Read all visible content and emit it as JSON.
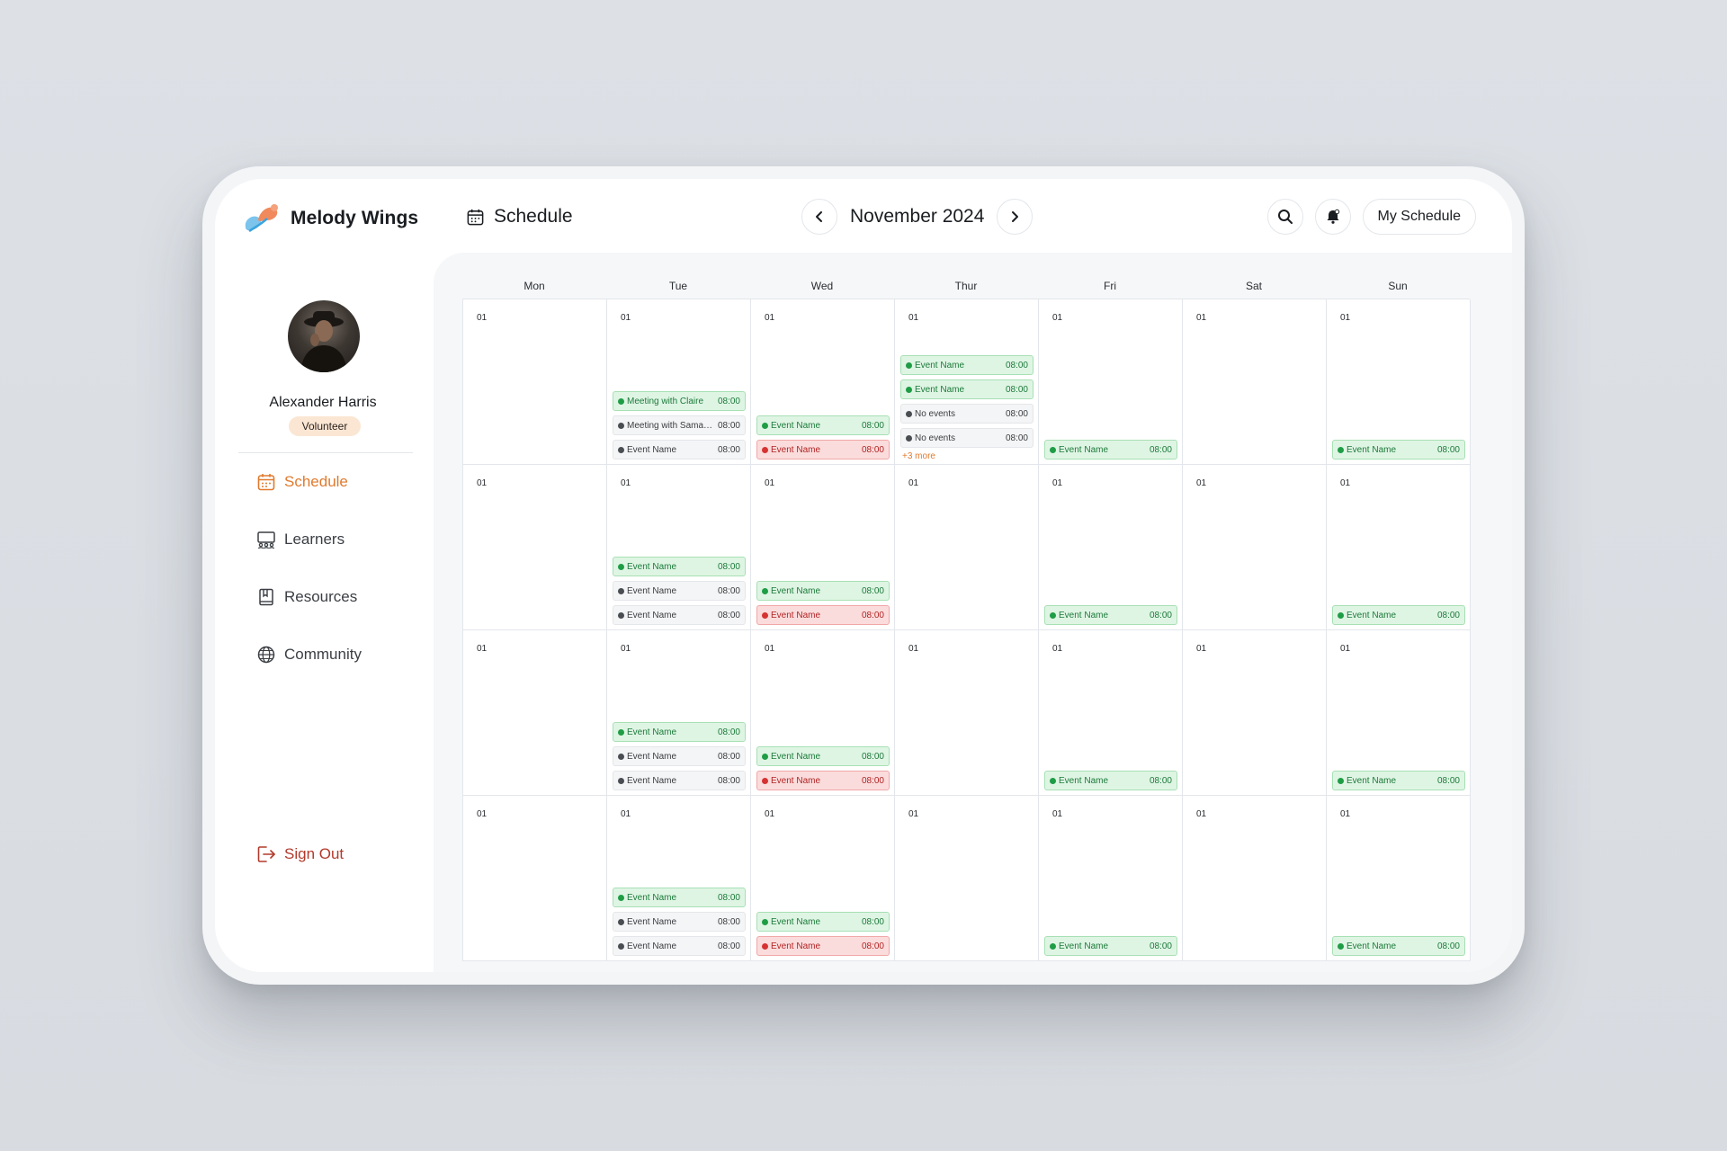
{
  "app": {
    "name": "Melody Wings"
  },
  "header": {
    "page_title": "Schedule",
    "month": "November 2024",
    "my_schedule_label": "My Schedule"
  },
  "user": {
    "name": "Alexander Harris",
    "role": "Volunteer"
  },
  "sidebar": {
    "items": [
      {
        "label": "Schedule",
        "icon": "calendar-icon",
        "active": true
      },
      {
        "label": "Learners",
        "icon": "learners-icon"
      },
      {
        "label": "Resources",
        "icon": "book-icon"
      },
      {
        "label": "Community",
        "icon": "globe-icon"
      }
    ],
    "sign_out": "Sign Out"
  },
  "colors": {
    "accent": "#e07a2e",
    "green": "#1f9d46",
    "red": "#d63232",
    "signout": "#b23a2c"
  },
  "calendar": {
    "days": [
      "Mon",
      "Tue",
      "Wed",
      "Thur",
      "Fri",
      "Sat",
      "Sun"
    ],
    "weeks": [
      [
        {
          "day": "01",
          "events": []
        },
        {
          "day": "01",
          "events": [
            {
              "name": "Meeting with Claire",
              "time": "08:00",
              "status": "green"
            },
            {
              "name": "Meeting with Samantha",
              "time": "08:00",
              "status": "grey"
            },
            {
              "name": "Event Name",
              "time": "08:00",
              "status": "grey"
            }
          ]
        },
        {
          "day": "01",
          "events": [
            {
              "name": "Event Name",
              "time": "08:00",
              "status": "green"
            },
            {
              "name": "Event Name",
              "time": "08:00",
              "status": "red"
            }
          ]
        },
        {
          "day": "01",
          "events": [
            {
              "name": "Event Name",
              "time": "08:00",
              "status": "green"
            },
            {
              "name": "Event Name",
              "time": "08:00",
              "status": "green"
            },
            {
              "name": "No events",
              "time": "08:00",
              "status": "grey"
            },
            {
              "name": "No events",
              "time": "08:00",
              "status": "grey"
            }
          ],
          "more": "+3 more"
        },
        {
          "day": "01",
          "events": [
            {
              "name": "Event Name",
              "time": "08:00",
              "status": "green"
            }
          ]
        },
        {
          "day": "01",
          "events": []
        },
        {
          "day": "01",
          "events": [
            {
              "name": "Event Name",
              "time": "08:00",
              "status": "green"
            }
          ]
        }
      ],
      [
        {
          "day": "01",
          "events": []
        },
        {
          "day": "01",
          "events": [
            {
              "name": "Event Name",
              "time": "08:00",
              "status": "green"
            },
            {
              "name": "Event Name",
              "time": "08:00",
              "status": "grey"
            },
            {
              "name": "Event Name",
              "time": "08:00",
              "status": "grey"
            }
          ]
        },
        {
          "day": "01",
          "events": [
            {
              "name": "Event Name",
              "time": "08:00",
              "status": "green"
            },
            {
              "name": "Event Name",
              "time": "08:00",
              "status": "red"
            }
          ]
        },
        {
          "day": "01",
          "events": []
        },
        {
          "day": "01",
          "events": [
            {
              "name": "Event Name",
              "time": "08:00",
              "status": "green"
            }
          ]
        },
        {
          "day": "01",
          "events": []
        },
        {
          "day": "01",
          "events": [
            {
              "name": "Event Name",
              "time": "08:00",
              "status": "green"
            }
          ]
        }
      ],
      [
        {
          "day": "01",
          "events": []
        },
        {
          "day": "01",
          "events": [
            {
              "name": "Event Name",
              "time": "08:00",
              "status": "green"
            },
            {
              "name": "Event Name",
              "time": "08:00",
              "status": "grey"
            },
            {
              "name": "Event Name",
              "time": "08:00",
              "status": "grey"
            }
          ]
        },
        {
          "day": "01",
          "events": [
            {
              "name": "Event Name",
              "time": "08:00",
              "status": "green"
            },
            {
              "name": "Event Name",
              "time": "08:00",
              "status": "red"
            }
          ]
        },
        {
          "day": "01",
          "events": []
        },
        {
          "day": "01",
          "events": [
            {
              "name": "Event Name",
              "time": "08:00",
              "status": "green"
            }
          ]
        },
        {
          "day": "01",
          "events": []
        },
        {
          "day": "01",
          "events": [
            {
              "name": "Event Name",
              "time": "08:00",
              "status": "green"
            }
          ]
        }
      ],
      [
        {
          "day": "01",
          "events": []
        },
        {
          "day": "01",
          "events": [
            {
              "name": "Event Name",
              "time": "08:00",
              "status": "green"
            },
            {
              "name": "Event Name",
              "time": "08:00",
              "status": "grey"
            },
            {
              "name": "Event Name",
              "time": "08:00",
              "status": "grey"
            }
          ]
        },
        {
          "day": "01",
          "events": [
            {
              "name": "Event Name",
              "time": "08:00",
              "status": "green"
            },
            {
              "name": "Event Name",
              "time": "08:00",
              "status": "red"
            }
          ]
        },
        {
          "day": "01",
          "events": []
        },
        {
          "day": "01",
          "events": [
            {
              "name": "Event Name",
              "time": "08:00",
              "status": "green"
            }
          ]
        },
        {
          "day": "01",
          "events": []
        },
        {
          "day": "01",
          "events": [
            {
              "name": "Event Name",
              "time": "08:00",
              "status": "green"
            }
          ]
        }
      ]
    ]
  }
}
